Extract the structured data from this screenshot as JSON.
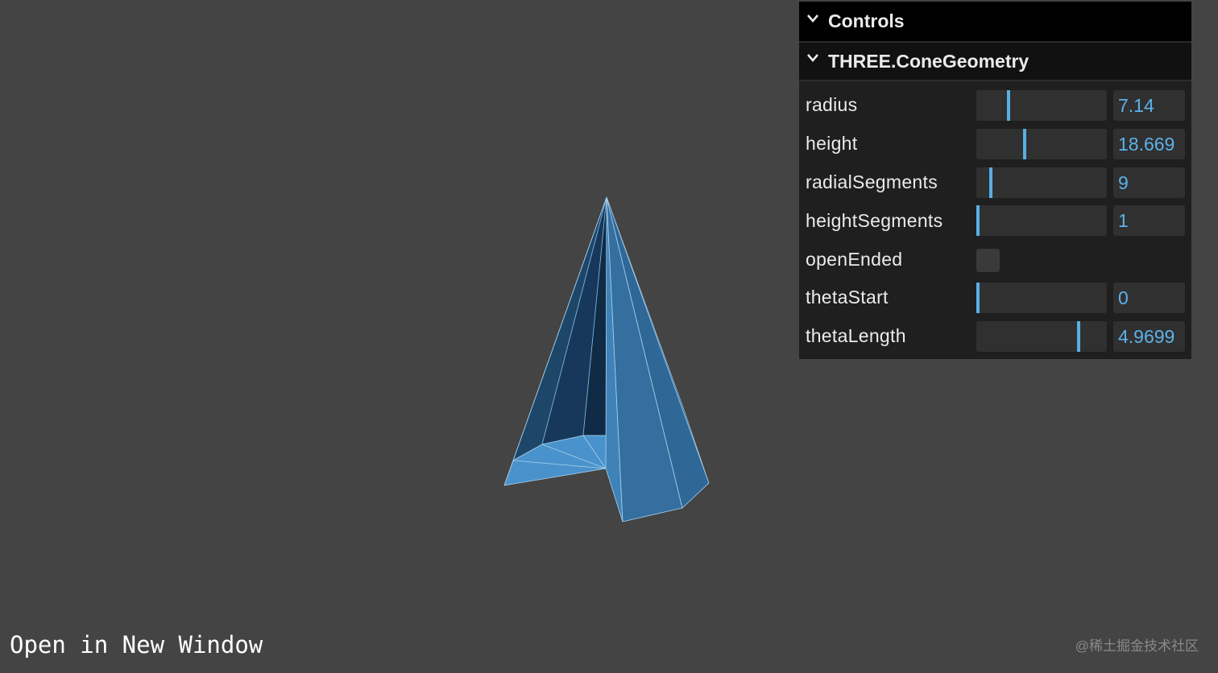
{
  "scene": {
    "mesh": "THREE.ConeGeometry",
    "colors": {
      "background": "#444444",
      "face_light": "#3f85bd",
      "face_mid": "#336f9f",
      "face_dark": "#1b3f60",
      "face_darkest": "#102c44",
      "wireframe": "#a9d2f0"
    }
  },
  "gui": {
    "title": "Controls",
    "folder": "THREE.ConeGeometry",
    "accent_color": "#5cb2ea",
    "controls": [
      {
        "label": "radius",
        "type": "slider",
        "value": "7.14",
        "fraction": 0.24
      },
      {
        "label": "height",
        "type": "slider",
        "value": "18.669",
        "fraction": 0.37
      },
      {
        "label": "radialSegments",
        "type": "slider",
        "value": "9",
        "fraction": 0.1
      },
      {
        "label": "heightSegments",
        "type": "slider",
        "value": "1",
        "fraction": 0.0
      },
      {
        "label": "openEnded",
        "type": "checkbox",
        "checked": false
      },
      {
        "label": "thetaStart",
        "type": "slider",
        "value": "0",
        "fraction": 0.0
      },
      {
        "label": "thetaLength",
        "type": "slider",
        "value": "4.9699",
        "fraction": 0.79
      }
    ],
    "icons": {
      "title_chevron": "chevron-down-icon",
      "folder_chevron": "chevron-down-icon"
    }
  },
  "footer": {
    "open_link": "Open in New Window",
    "watermark": "@稀土掘金技术社区"
  }
}
